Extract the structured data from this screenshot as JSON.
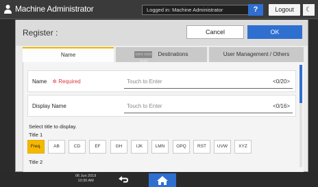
{
  "topbar": {
    "title": "Machine Administrator",
    "logged_in": "Logged in: Machine Administrator",
    "help_label": "?",
    "logout_label": "Logout",
    "moon_label": "☾"
  },
  "dialog": {
    "title": "Register :",
    "cancel_label": "Cancel",
    "ok_label": "OK",
    "tabs": [
      {
        "label": "Name",
        "active": true
      },
      {
        "label": "Destinations",
        "badge": "▭▭ ▭▭ ▭▭",
        "active": false
      },
      {
        "label": "User Management / Others",
        "active": false
      }
    ],
    "fields": [
      {
        "label": "Name",
        "required_text": "✲ Required",
        "placeholder": "Touch to Enter",
        "counter": "<0/20>"
      },
      {
        "label": "Display Name",
        "placeholder": "Touch to Enter",
        "counter": "<0/16>"
      }
    ],
    "select_title_text": "Select title to display.",
    "title1_label": "Title 1",
    "title_buttons": [
      {
        "label": "Freq.",
        "selected": true
      },
      {
        "label": "AB",
        "selected": false
      },
      {
        "label": "CD",
        "selected": false
      },
      {
        "label": "EF",
        "selected": false
      },
      {
        "label": "GH",
        "selected": false
      },
      {
        "label": "IJK",
        "selected": false
      },
      {
        "label": "LMN",
        "selected": false
      },
      {
        "label": "OPQ",
        "selected": false
      },
      {
        "label": "RST",
        "selected": false
      },
      {
        "label": "UVW",
        "selected": false
      },
      {
        "label": "XYZ",
        "selected": false
      }
    ],
    "title2_label": "Title 2"
  },
  "bottombar": {
    "date": "06 Jun 2019",
    "time": "10:30 AM"
  },
  "colors": {
    "accent_blue": "#2f6fd0",
    "selected_yellow": "#f5b800",
    "required_red": "#d9363e"
  },
  "icons": [
    "user-icon",
    "help-icon",
    "moon-icon",
    "back-arrow-icon",
    "home-icon"
  ]
}
